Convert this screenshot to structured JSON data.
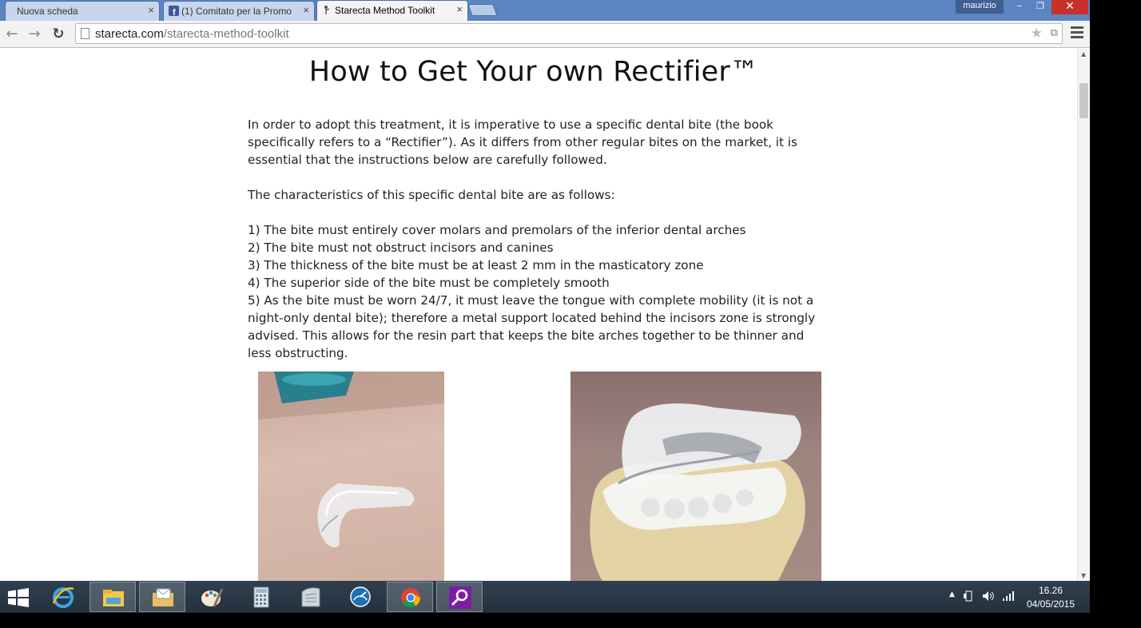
{
  "browser": {
    "tabs": [
      {
        "title": "Nuova scheda",
        "active": false
      },
      {
        "title": "(1) Comitato per la Promo",
        "active": false
      },
      {
        "title": "Starecta Method Toolkit",
        "active": true
      }
    ],
    "tab_close_glyph": "×",
    "user": "maurizio",
    "window_controls": {
      "minimize": "–",
      "maximize": "❐",
      "close": "✕"
    },
    "nav": {
      "back": "←",
      "forward": "→",
      "reload": "↻"
    },
    "url": {
      "domain": "starecta.com",
      "path": "/starecta-method-toolkit"
    },
    "star_glyph": "★",
    "ext_glyph": "⧉"
  },
  "page": {
    "title": "How to Get Your own Rectifier™",
    "intro": "In order to adopt this treatment, it is imperative to use a specific dental bite (the book specifically refers to a “Rectifier”). As it differs from other regular bites on the market, it is essential that the instructions below are carefully followed.",
    "characteristics_heading": "The characteristics of this specific dental bite are as follows:",
    "list": [
      "1) The bite must entirely cover molars and premolars of the inferior dental arches",
      "2) The bite must not obstruct incisors and canines",
      "3) The thickness of the bite must be at least 2 mm in the masticatory zone",
      "4) The superior side of the bite must be completely smooth",
      "5) As the bite must be worn 24/7, it must leave the tongue with complete mobility (it is not a night-only dental bite); therefore a metal support located behind the incisors zone is strongly advised. This allows for the resin part that keeps the bite arches together to be thinner and less obstructing."
    ]
  },
  "scrollbar": {
    "up": "▲",
    "down": "▼"
  },
  "taskbar": {
    "apps": [
      "start-icon",
      "internet-explorer-icon",
      "file-explorer-icon",
      "mail-folder-icon",
      "paint-icon",
      "calculator-icon",
      "scanner-icon",
      "speedometer-icon",
      "chrome-icon",
      "search-app-icon"
    ],
    "tray": {
      "chevron": "▲",
      "time": "16.26",
      "date": "04/05/2015"
    }
  },
  "colors": {
    "titlebar": "#5c84c0",
    "close": "#c7312a",
    "taskbar": "#2b3947"
  }
}
